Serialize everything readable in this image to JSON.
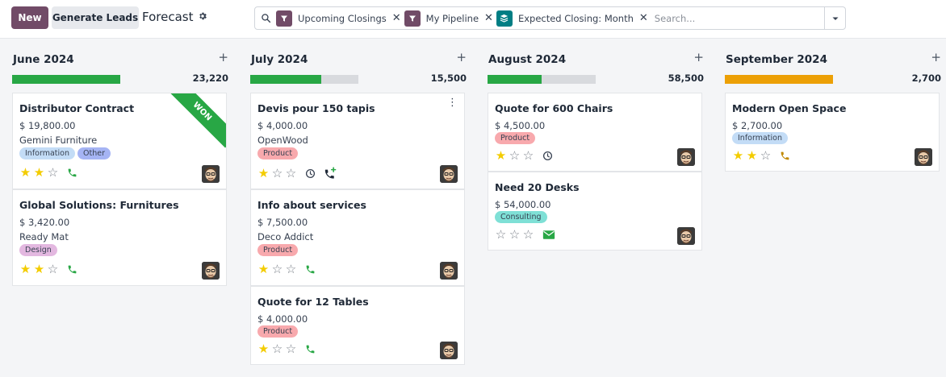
{
  "toolbar": {
    "new_label": "New",
    "generate_leads_label": "Generate Leads",
    "title": "Forecast"
  },
  "search": {
    "facets": [
      {
        "label": "Upcoming Closings",
        "icon": "filter-icon",
        "color": "#714b67"
      },
      {
        "label": "My Pipeline",
        "icon": "filter-icon",
        "color": "#714b67"
      },
      {
        "label": "Expected Closing: Month",
        "icon": "group-by-icon",
        "color": "#017e84"
      }
    ],
    "placeholder": "Search..."
  },
  "columns": [
    {
      "title": "June 2024",
      "total": "23,220",
      "progress": {
        "won_fraction": 1.0,
        "color": "#28a745"
      },
      "cards": [
        {
          "name": "Distributor Contract",
          "revenue": "$ 19,800.00",
          "partner": "Gemini Furniture",
          "tags": [
            {
              "label": "Information",
              "color": "#c3dcf6"
            },
            {
              "label": "Other",
              "color": "#a5b4f4"
            }
          ],
          "stars": 2,
          "activity": "phone-icon",
          "activity_color": "#28a745",
          "ribbon": "WON"
        },
        {
          "name": "Global Solutions: Furnitures",
          "revenue": "$ 3,420.00",
          "partner": "Ready Mat",
          "tags": [
            {
              "label": "Design",
              "color": "#e3b8e0"
            }
          ],
          "stars": 2,
          "activity": "phone-icon",
          "activity_color": "#28a745"
        }
      ]
    },
    {
      "title": "July 2024",
      "total": "15,500",
      "progress": {
        "won_fraction": 0.66,
        "color": "#28a745"
      },
      "cards": [
        {
          "name": "Devis pour 150 tapis",
          "revenue": "$ 4,000.00",
          "partner": "OpenWood",
          "tags": [
            {
              "label": "Product",
              "color": "#f8a9ad"
            }
          ],
          "stars": 1,
          "activity": "clock-icon",
          "activity_color": "#374151",
          "extra_activity": "phone-plus-icon",
          "kebab": true
        },
        {
          "name": "Info about services",
          "revenue": "$ 7,500.00",
          "partner": "Deco Addict",
          "tags": [
            {
              "label": "Product",
              "color": "#f8a9ad"
            }
          ],
          "stars": 1,
          "activity": "phone-icon",
          "activity_color": "#28a745"
        },
        {
          "name": "Quote for 12 Tables",
          "revenue": "$ 4,000.00",
          "partner": "",
          "tags": [
            {
              "label": "Product",
              "color": "#f8a9ad"
            }
          ],
          "stars": 1,
          "activity": "phone-icon",
          "activity_color": "#28a745"
        }
      ]
    },
    {
      "title": "August 2024",
      "total": "58,500",
      "progress": {
        "won_fraction": 0.5,
        "color": "#28a745"
      },
      "cards": [
        {
          "name": "Quote for 600 Chairs",
          "revenue": "$ 4,500.00",
          "partner": "",
          "tags": [
            {
              "label": "Product",
              "color": "#f8a9ad"
            }
          ],
          "stars": 1,
          "activity": "clock-icon",
          "activity_color": "#374151"
        },
        {
          "name": "Need 20 Desks",
          "revenue": "$ 54,000.00",
          "partner": "",
          "tags": [
            {
              "label": "Consulting",
              "color": "#7fe0d6"
            }
          ],
          "stars": 0,
          "activity": "envelope-icon",
          "activity_color": "#28a745"
        }
      ]
    },
    {
      "title": "September 2024",
      "total": "2,700",
      "progress": {
        "won_fraction": 1.0,
        "color": "#eca006"
      },
      "cards": [
        {
          "name": "Modern Open Space",
          "revenue": "$ 2,700.00",
          "partner": "",
          "tags": [
            {
              "label": "Information",
              "color": "#c3dcf6"
            }
          ],
          "stars": 2,
          "activity": "phone-icon",
          "activity_color": "#c08800"
        }
      ]
    }
  ]
}
